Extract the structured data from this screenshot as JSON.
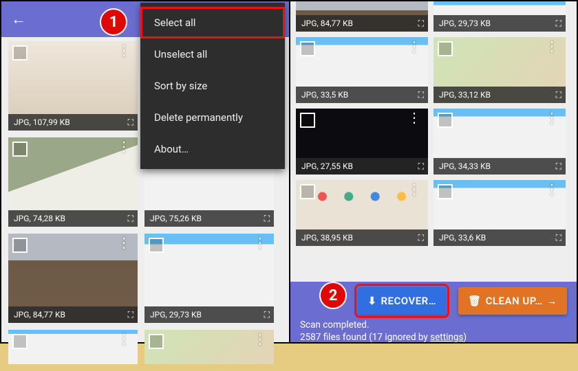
{
  "annotations": {
    "step1": "1",
    "step2": "2"
  },
  "left": {
    "menu": {
      "select_all": "Select all",
      "unselect_all": "Unselect all",
      "sort_by_size": "Sort by size",
      "delete_permanently": "Delete permanently",
      "about": "About…"
    },
    "thumbs": [
      {
        "info": "JPG, 107,99 KB"
      },
      {
        "info": "JPG, 74,28 KB"
      },
      {
        "info": "JPG, 75,26 KB"
      },
      {
        "info": "JPG, 84,77 KB"
      },
      {
        "info": "JPG, 29,73 KB"
      }
    ]
  },
  "right": {
    "thumbs": [
      {
        "info": "JPG, 84,77 KB"
      },
      {
        "info": "JPG, 29,73 KB"
      },
      {
        "info": "JPG, 33,5 KB"
      },
      {
        "info": "JPG, 33,12 KB"
      },
      {
        "info": "JPG, 27,55 KB"
      },
      {
        "info": "JPG, 34,33 KB"
      },
      {
        "info": "JPG, 38,95 KB"
      },
      {
        "info": "JPG, 33,6 KB"
      }
    ],
    "buttons": {
      "recover": "RECOVER…",
      "cleanup": "CLEAN UP…"
    },
    "status": {
      "line1": "Scan completed.",
      "line2_a": "2587 files found (17 ignored by ",
      "settings": "settings",
      "line2_b": ")"
    }
  }
}
